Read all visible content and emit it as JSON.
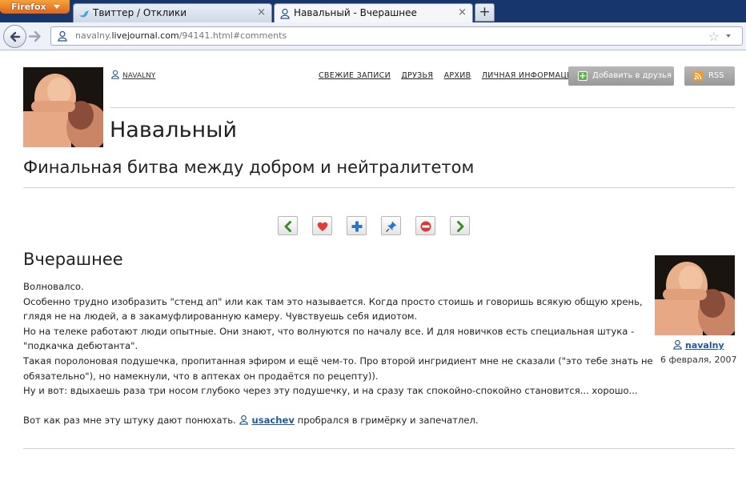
{
  "browser": {
    "menu_button": "Firefox",
    "tabs": [
      {
        "title": "Твиттер / Отклики",
        "icon": "twitter-bird-icon",
        "active": false
      },
      {
        "title": "Навальный - Вчерашнее",
        "icon": "lj-user-icon",
        "active": true
      }
    ],
    "tab_close": "×",
    "new_tab": "+",
    "url": {
      "prefix": "navalny.",
      "domain": "livejournal.com",
      "path": "/94141.html#comments"
    }
  },
  "journal": {
    "username": "NAVALNY",
    "title": "Навальный",
    "subtitle": "Финальная битва между добром и нейтралитетом",
    "nav": [
      "СВЕЖИЕ ЗАПИСИ",
      "ДРУЗЬЯ",
      "АРХИВ",
      "ЛИЧНАЯ ИНФОРМАЦИЯ"
    ],
    "add_friend": "Добавить в друзья",
    "rss": "RSS"
  },
  "entry": {
    "title": "Вчерашнее",
    "paragraphs": [
      "Волновалсо.",
      "Особенно трудно изобразить \"стенд ап\" или как там это называется. Когда просто стоишь и говоришь всякую общую хрень,",
      "глядя не на людей, а в закамуфлированную камеру. Чувствуешь себя идиотом.",
      "Но на телеке работают люди опытные. Они знают, что волнуются по началу все. И для новичков есть специальная штука -",
      "\"подкачка дебютанта\".",
      "Такая поролоновая подушечка, пропитанная эфиром и ещё чем-то. Про второй ингридиент мне не сказали (\"это тебе знать не",
      "обязательно\"), но намекнули, что в аптеках он продаётся по рецепту)).",
      "Ну и вот: вдыхаешь раза три носом глубоко через эту подушечку, и на сразу так спокойно-спокойно становится... хорошо..."
    ],
    "last_line_before": "Вот как раз мне эту штуку дают понюхать. ",
    "mentioned_user": "usachev",
    "last_line_after": " пробрался в гримёрку и запечатлел.",
    "poster": "navalny",
    "date": "6 февраля, 2007"
  },
  "colors": {
    "chrome_dark": "#17366b",
    "link_blue": "#1f5a9c",
    "button_gray": "#a8a8a8"
  }
}
